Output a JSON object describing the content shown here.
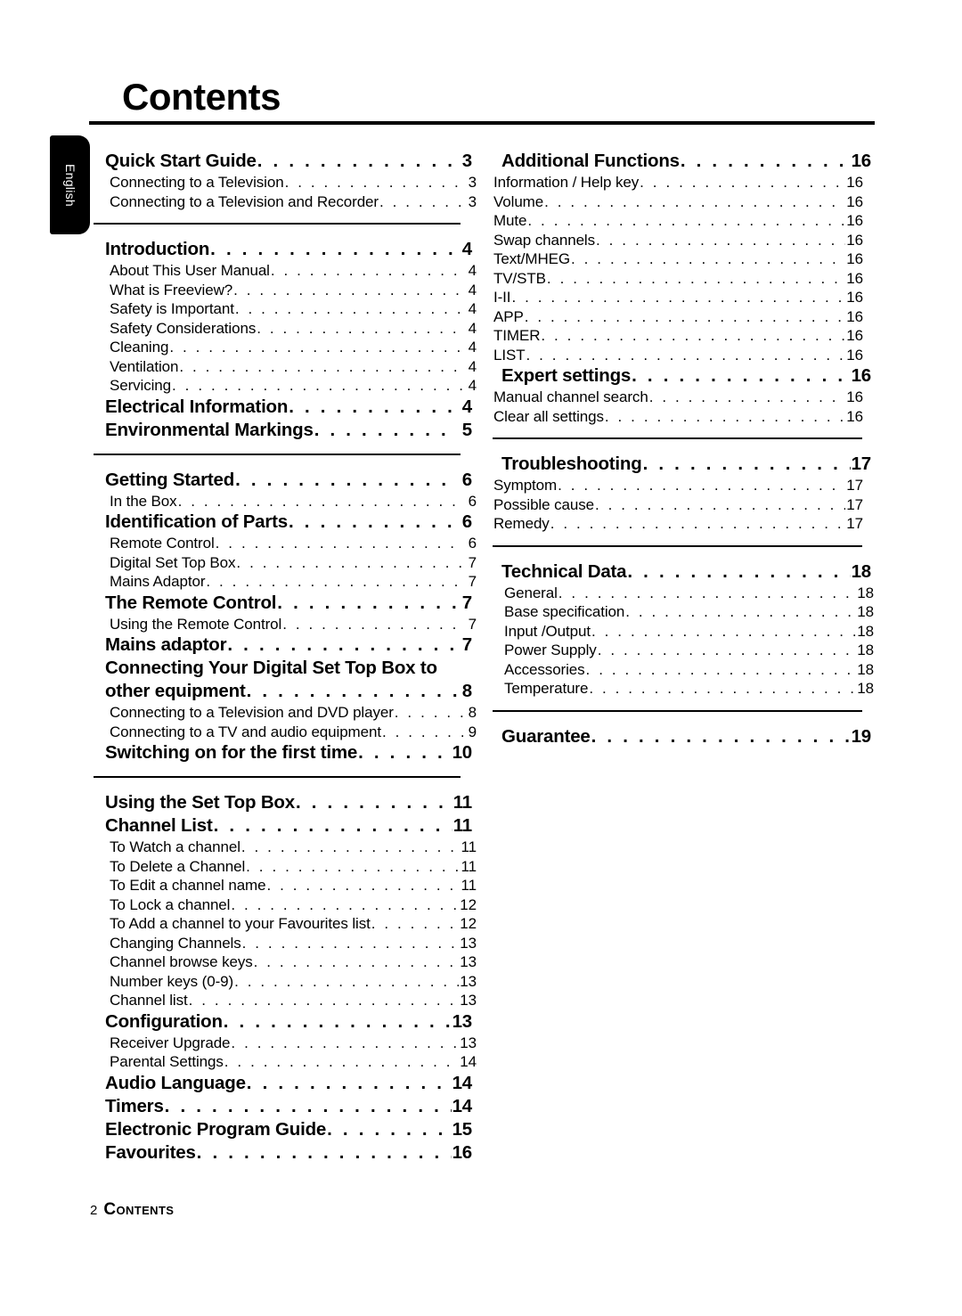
{
  "page": {
    "title": "Contents",
    "language_tab": "English"
  },
  "footer": {
    "page_number": "2",
    "label": "Contents"
  },
  "leader_dots": ". . . . . . . . . . . . . . . . . . . . . . . . . . . . . . . . . . . . . . . . . . . . . . . . . . . . . . . . . .",
  "left_column": {
    "groups": [
      {
        "rule_above": false,
        "rows": [
          {
            "type": "heading",
            "label": "Quick Start Guide",
            "page": "3"
          },
          {
            "type": "sub",
            "label": "Connecting to a Television",
            "page": "3"
          },
          {
            "type": "sub",
            "label": "Connecting to a Television and Recorder",
            "page": "3"
          }
        ]
      },
      {
        "rule_above": true,
        "rows": [
          {
            "type": "heading",
            "label": "Introduction",
            "page": "4"
          },
          {
            "type": "sub",
            "label": "About This User Manual",
            "page": "4"
          },
          {
            "type": "sub",
            "label": "What is Freeview?",
            "page": "4"
          },
          {
            "type": "sub",
            "label": "Safety is Important",
            "page": "4"
          },
          {
            "type": "sub",
            "label": "Safety Considerations",
            "page": "4"
          },
          {
            "type": "sub",
            "label": "Cleaning",
            "page": "4"
          },
          {
            "type": "sub",
            "label": "Ventilation",
            "page": "4"
          },
          {
            "type": "sub",
            "label": "Servicing",
            "page": "4"
          },
          {
            "type": "heading",
            "label": "Electrical Information",
            "page": "4"
          },
          {
            "type": "heading",
            "label": "Environmental Markings",
            "page": "5"
          }
        ]
      },
      {
        "rule_above": true,
        "rows": [
          {
            "type": "heading",
            "label": "Getting Started",
            "page": "6"
          },
          {
            "type": "sub",
            "label": "In the Box",
            "page": "6"
          },
          {
            "type": "heading",
            "label": "Identification of Parts",
            "page": "6"
          },
          {
            "type": "sub",
            "label": "Remote Control",
            "page": "6"
          },
          {
            "type": "sub",
            "label": "Digital Set Top Box",
            "page": "7"
          },
          {
            "type": "sub",
            "label": "Mains Adaptor",
            "page": "7"
          },
          {
            "type": "heading",
            "label": "The Remote Control",
            "page": "7"
          },
          {
            "type": "sub",
            "label": "Using the Remote Control",
            "page": "7"
          },
          {
            "type": "heading",
            "label": "Mains adaptor",
            "page": "7"
          },
          {
            "type": "heading-firstline",
            "label": "Connecting Your Digital Set Top Box to"
          },
          {
            "type": "heading",
            "label": "other equipment",
            "page": "8"
          },
          {
            "type": "sub",
            "label": "Connecting to a Television and DVD player",
            "page": "8"
          },
          {
            "type": "sub",
            "label": "Connecting to a TV and audio equipment",
            "page": "9"
          },
          {
            "type": "heading",
            "label": "Switching on for the first time",
            "page": "10"
          }
        ]
      },
      {
        "rule_above": true,
        "rows": [
          {
            "type": "heading",
            "label": "Using the Set Top Box",
            "page": "11"
          },
          {
            "type": "heading",
            "label": "Channel List",
            "page": "11"
          },
          {
            "type": "sub",
            "label": "To Watch a channel",
            "page": "11"
          },
          {
            "type": "sub",
            "label": "To Delete a Channel",
            "page": "11"
          },
          {
            "type": "sub",
            "label": "To Edit a channel name",
            "page": "11"
          },
          {
            "type": "sub",
            "label": "To Lock a channel",
            "page": "12"
          },
          {
            "type": "sub",
            "label": "To Add a channel to your Favourites list",
            "page": "12"
          },
          {
            "type": "sub",
            "label": "Changing Channels",
            "page": "13"
          },
          {
            "type": "sub",
            "label": "Channel browse keys",
            "page": "13"
          },
          {
            "type": "sub",
            "label": "Number keys (0-9)",
            "page": "13"
          },
          {
            "type": "sub",
            "label": "Channel list",
            "page": "13"
          },
          {
            "type": "heading",
            "label": "Configuration",
            "page": "13"
          },
          {
            "type": "sub",
            "label": "Receiver Upgrade",
            "page": "13"
          },
          {
            "type": "sub",
            "label": "Parental Settings",
            "page": "14"
          },
          {
            "type": "heading",
            "label": "Audio Language",
            "page": "14"
          },
          {
            "type": "heading",
            "label": "Timers",
            "page": "14"
          },
          {
            "type": "heading",
            "label": "Electronic Program Guide",
            "page": "15"
          },
          {
            "type": "heading",
            "label": "Favourites",
            "page": "16"
          }
        ]
      }
    ]
  },
  "right_column": {
    "groups": [
      {
        "rule_above": false,
        "rows": [
          {
            "type": "heading",
            "label": "Additional Functions",
            "page": "16"
          },
          {
            "type": "sub",
            "label": "Information / Help key",
            "page": "16"
          },
          {
            "type": "sub",
            "label": "Volume",
            "page": "16"
          },
          {
            "type": "sub",
            "label": "Mute",
            "page": "16"
          },
          {
            "type": "sub",
            "label": "Swap channels",
            "page": "16"
          },
          {
            "type": "sub",
            "label": "Text/MHEG",
            "page": "16"
          },
          {
            "type": "sub",
            "label": "TV/STB",
            "page": "16"
          },
          {
            "type": "sub",
            "label": "I-II",
            "page": "16"
          },
          {
            "type": "sub",
            "label": "APP",
            "page": "16"
          },
          {
            "type": "sub",
            "label": "TIMER",
            "page": "16"
          },
          {
            "type": "sub",
            "label": "LIST",
            "page": "16"
          },
          {
            "type": "heading",
            "label": "Expert settings",
            "page": "16"
          },
          {
            "type": "sub",
            "label": "Manual channel search",
            "page": "16"
          },
          {
            "type": "sub",
            "label": "Clear all settings",
            "page": "16"
          }
        ]
      },
      {
        "rule_above": true,
        "rows": [
          {
            "type": "heading",
            "label": "Troubleshooting",
            "page": "17"
          },
          {
            "type": "sub",
            "label": "Symptom",
            "page": "17"
          },
          {
            "type": "sub",
            "label": "Possible cause",
            "page": "17"
          },
          {
            "type": "sub",
            "label": "Remedy",
            "page": "17"
          }
        ]
      },
      {
        "rule_above": true,
        "rows": [
          {
            "type": "heading",
            "label": "Technical Data",
            "page": "18"
          },
          {
            "type": "sub-tech",
            "label": "General",
            "page": "18"
          },
          {
            "type": "sub-tech",
            "label": "Base specification",
            "page": "18"
          },
          {
            "type": "sub-tech",
            "label": "Input /Output",
            "page": "18"
          },
          {
            "type": "sub-tech",
            "label": "Power Supply",
            "page": "18"
          },
          {
            "type": "sub-tech",
            "label": "Accessories",
            "page": "18"
          },
          {
            "type": "sub-tech",
            "label": "Temperature",
            "page": "18"
          }
        ]
      },
      {
        "rule_above": true,
        "rows": [
          {
            "type": "heading",
            "label": "Guarantee",
            "page": "19"
          }
        ]
      }
    ]
  }
}
